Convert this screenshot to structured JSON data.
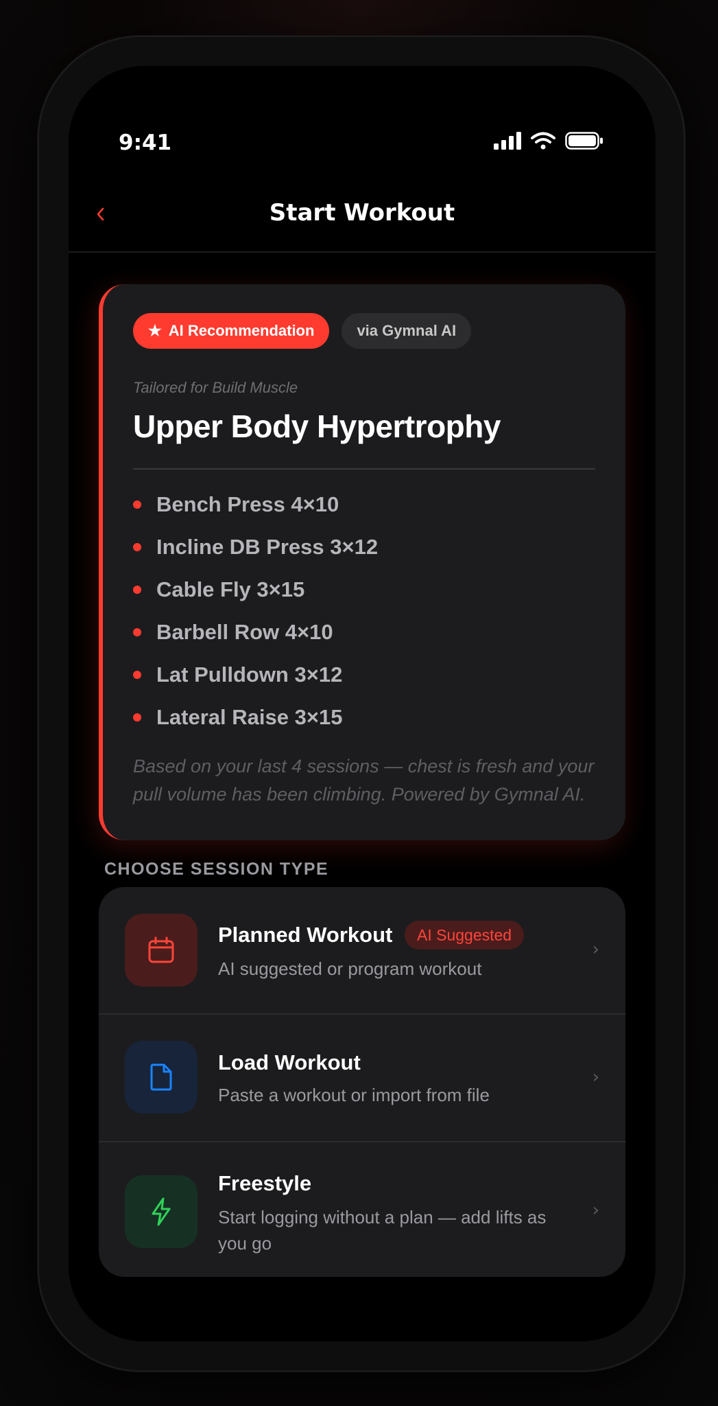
{
  "status": {
    "time": "9:41"
  },
  "nav": {
    "title": "Start Workout",
    "back": "‹"
  },
  "recommendation": {
    "badge_label": "AI Recommendation",
    "badge_icon": "★",
    "source": "via Gymnal AI",
    "tailored": "Tailored for Build Muscle",
    "title": "Upper Body Hypertrophy",
    "exercises": [
      "Bench Press 4×10",
      "Incline DB Press 3×12",
      "Cable Fly 3×15",
      "Barbell Row 4×10",
      "Lat Pulldown 3×12",
      "Lateral Raise 3×15"
    ],
    "rationale": "Based on your last 4 sessions — chest is fresh and your pull volume has been climbing. Powered by Gymnal AI."
  },
  "sessions": {
    "label": "CHOOSE SESSION TYPE",
    "items": [
      {
        "title": "Planned Workout",
        "badge": "AI Suggested",
        "desc": "AI suggested or program workout",
        "icon": "calendar-icon"
      },
      {
        "title": "Load Workout",
        "desc": "Paste a workout or import from file",
        "icon": "file-icon"
      },
      {
        "title": "Freestyle",
        "desc": "Start logging without a plan — add lifts as you go",
        "icon": "lightning-icon"
      }
    ],
    "chevron": "›"
  },
  "colors": {
    "accent": "#ff3b30",
    "card": "#1c1c1e",
    "planned_icon_bg": "#4a1c1c",
    "load_icon_bg": "#17243a",
    "freestyle_icon_bg": "#173024"
  }
}
